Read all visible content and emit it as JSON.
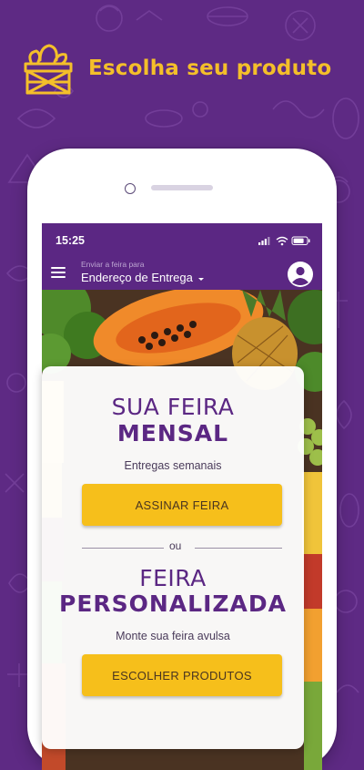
{
  "promo": {
    "title": "Escolha seu produto"
  },
  "status_bar": {
    "time": "15:25"
  },
  "header": {
    "address_hint": "Enviar a feira para",
    "address_value": "Endereço de Entrega"
  },
  "card": {
    "mensal_line1": "SUA FEIRA",
    "mensal_line2": "MENSAL",
    "mensal_subtitle": "Entregas semanais",
    "subscribe_button": "ASSINAR FEIRA",
    "divider": "ou",
    "custom_line1": "FEIRA",
    "custom_line2": "PERSONALIZADA",
    "custom_subtitle": "Monte sua feira avulsa",
    "choose_button": "ESCOLHER PRODUTOS"
  },
  "colors": {
    "background": "#5e2a84",
    "accent_yellow": "#f6bf1b",
    "brand_purple": "#5b2783"
  }
}
